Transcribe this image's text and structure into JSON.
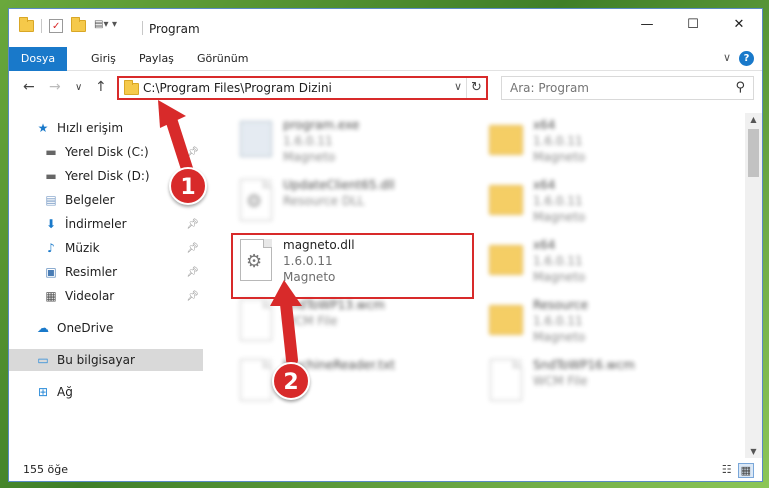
{
  "window": {
    "title": "Program",
    "controls": {
      "minimize": "—",
      "maximize": "☐",
      "close": "✕"
    }
  },
  "ribbon": {
    "tabs": [
      "Dosya",
      "Giriş",
      "Paylaş",
      "Görünüm"
    ],
    "expand": "∨",
    "help": "?"
  },
  "nav": {
    "back": "←",
    "forward": "→",
    "recent": "∨",
    "up": "↑"
  },
  "address": {
    "path": "C:\\Program Files\\Program Dizini",
    "refresh": "↻",
    "dropdown": "∨"
  },
  "search": {
    "placeholder": "Ara: Program"
  },
  "sidebar": {
    "items": [
      {
        "label": "Hızlı erişim",
        "icon": "star-icon"
      },
      {
        "label": "Yerel Disk (C:)",
        "icon": "drive-icon",
        "pinned": true
      },
      {
        "label": "Yerel Disk (D:)",
        "icon": "drive-icon"
      },
      {
        "label": "Belgeler",
        "icon": "documents-icon"
      },
      {
        "label": "İndirmeler",
        "icon": "download-icon",
        "pinned": true
      },
      {
        "label": "Müzik",
        "icon": "music-icon",
        "pinned": true
      },
      {
        "label": "Resimler",
        "icon": "pictures-icon",
        "pinned": true
      },
      {
        "label": "Videolar",
        "icon": "video-icon",
        "pinned": true
      },
      {
        "label": "OneDrive",
        "icon": "cloud-icon"
      },
      {
        "label": "Bu bilgisayar",
        "icon": "computer-icon",
        "selected": true
      },
      {
        "label": "Ağ",
        "icon": "network-icon"
      }
    ]
  },
  "files": [
    {
      "name": "program.exe",
      "line2": "1.6.0.11",
      "line3": "Magneto",
      "type": "exe",
      "blurred": true
    },
    {
      "name": "x64",
      "line2": "1.6.0.11",
      "line3": "Magneto",
      "type": "folder",
      "blurred": true
    },
    {
      "name": "UpdateClient65.dll",
      "line2": "Resource DLL",
      "line3": "",
      "type": "dll",
      "blurred": true
    },
    {
      "name": "x64",
      "line2": "1.6.0.11",
      "line3": "Magneto",
      "type": "folder",
      "blurred": true
    },
    {
      "name": "magneto.dll",
      "line2": "1.6.0.11",
      "line3": "Magneto",
      "type": "dll",
      "blurred": false
    },
    {
      "name": "x64",
      "line2": "1.6.0.11",
      "line3": "Magneto",
      "type": "folder",
      "blurred": true
    },
    {
      "name": "SndToWP13.wcm",
      "line2": "WCM File",
      "line3": "",
      "type": "doc",
      "blurred": true
    },
    {
      "name": "Resource",
      "line2": "1.6.0.11",
      "line3": "Magneto",
      "type": "folder",
      "blurred": true
    },
    {
      "name": "MachineReader.txt",
      "line2": "File",
      "line3": "",
      "type": "doc",
      "blurred": true
    },
    {
      "name": "SndToWP16.wcm",
      "line2": "WCM File",
      "line3": "",
      "type": "doc",
      "blurred": true
    }
  ],
  "status": {
    "count": "155 öğe"
  },
  "annotations": {
    "badge1": "1",
    "badge2": "2",
    "color": "#d82a2a"
  }
}
